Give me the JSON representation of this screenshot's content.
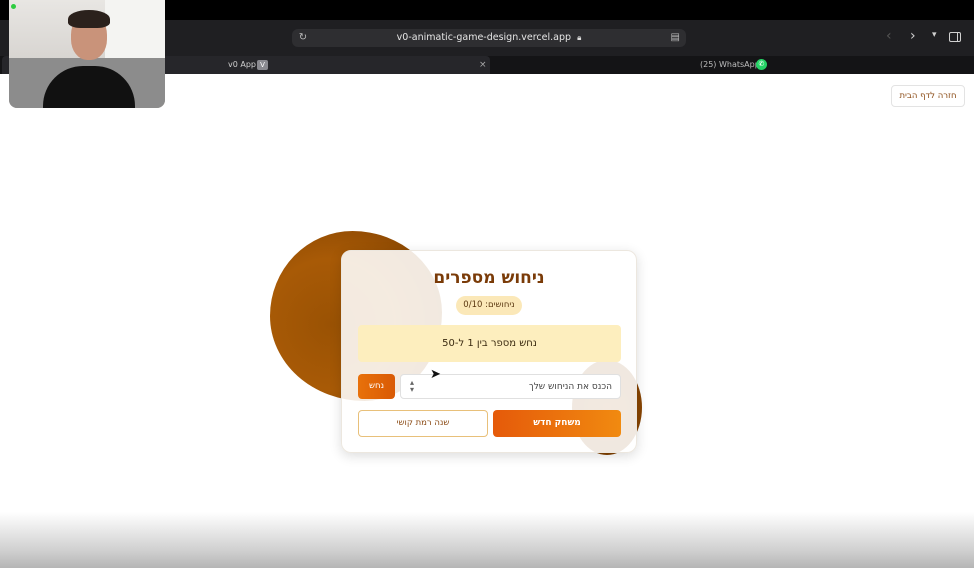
{
  "browser": {
    "url": "v0-animatic-game-design.vercel.app",
    "tabs": [
      {
        "label": "v0 App",
        "badge": "V",
        "close": "×"
      },
      {
        "label": "(25) WhatsApp"
      }
    ],
    "icons": {
      "reload": "reload-icon",
      "lock": "lock-icon",
      "reader": "reader-icon",
      "back": "back-arrow-icon",
      "forward": "forward-arrow-icon",
      "menu": "chevron-down-icon",
      "sidebar": "sidebar-icon"
    }
  },
  "page": {
    "home_button": "חזרה לדף הבית",
    "card": {
      "title": "ניחוש מספרים",
      "guess_count": "ניחושים: 0/10",
      "hint": "נחש מספר בין 1 ל-50",
      "input_placeholder": "הכנס את הניחוש שלך",
      "guess_button": "נחש",
      "new_game_button": "משחק חדש",
      "difficulty_button": "שנה רמת קושי"
    }
  },
  "colors": {
    "accent": "#e8710a",
    "title": "#7a3b08",
    "blob": "#9a5204",
    "hint_bg": "#fdeebe"
  }
}
